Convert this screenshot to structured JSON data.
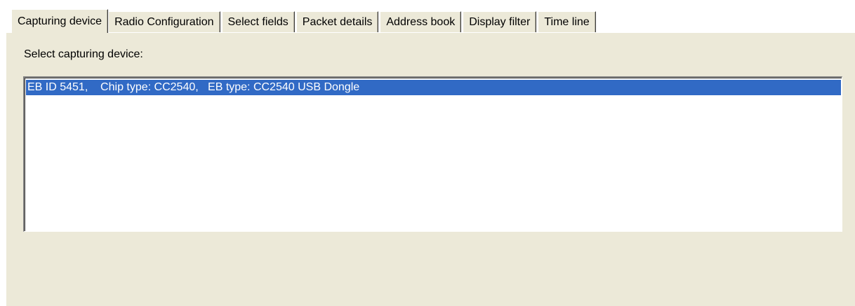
{
  "tabs": [
    {
      "label": "Capturing device",
      "active": true
    },
    {
      "label": "Radio Configuration",
      "active": false
    },
    {
      "label": "Select fields",
      "active": false
    },
    {
      "label": "Packet details",
      "active": false
    },
    {
      "label": "Address book",
      "active": false
    },
    {
      "label": "Display filter",
      "active": false
    },
    {
      "label": "Time line",
      "active": false
    }
  ],
  "capturing_device": {
    "prompt": "Select capturing device:",
    "devices": [
      {
        "label": "EB ID 5451,    Chip type: CC2540,   EB type: CC2540 USB Dongle",
        "selected": true
      }
    ]
  },
  "colors": {
    "face": "#ece9d8",
    "selection": "#316ac5",
    "selection_text": "#ffffff"
  }
}
